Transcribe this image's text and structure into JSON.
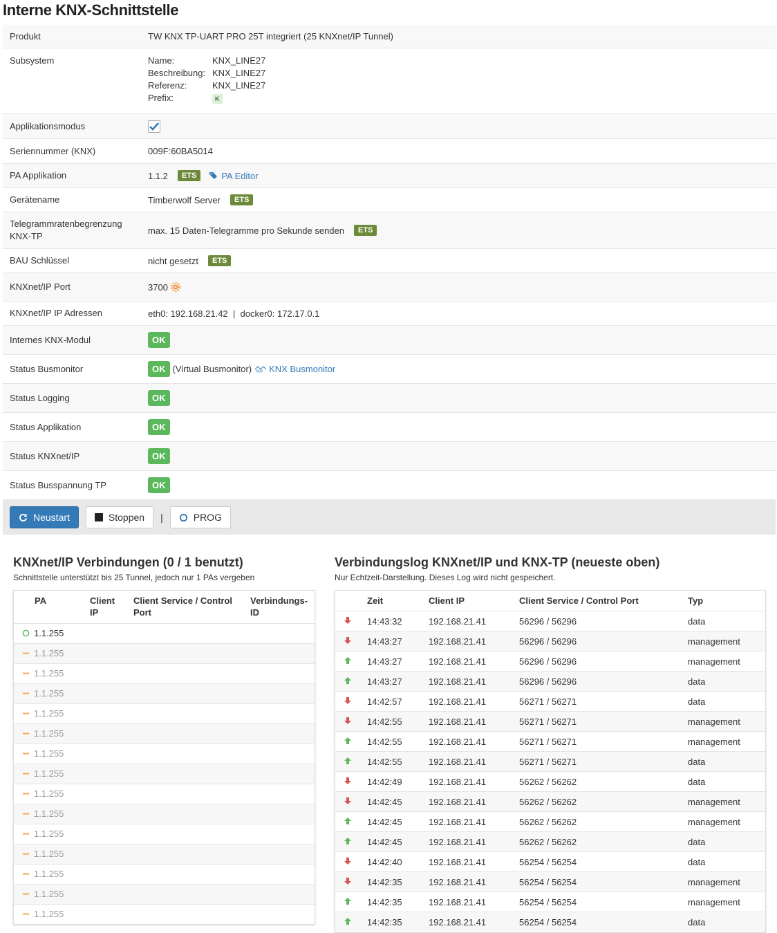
{
  "title": "Interne KNX-Schnittstelle",
  "props": {
    "produkt_label": "Produkt",
    "produkt_value": "TW KNX TP-UART PRO 25T integriert (25 KNXnet/IP Tunnel)",
    "subsystem_label": "Subsystem",
    "subsystem": {
      "name_label": "Name:",
      "name": "KNX_LINE27",
      "beschreibung_label": "Beschreibung:",
      "beschreibung": "KNX_LINE27",
      "referenz_label": "Referenz:",
      "referenz": "KNX_LINE27",
      "prefix_label": "Prefix:",
      "prefix": "K"
    },
    "appmodus_label": "Applikationsmodus",
    "seriennummer_label": "Seriennummer (KNX)",
    "seriennummer": "009F:60BA5014",
    "pa_label": "PA Applikation",
    "pa_value": "1.1.2",
    "ets": "ETS",
    "pa_editor": "PA Editor",
    "geraetename_label": "Gerätename",
    "geraetename": "Timberwolf Server",
    "rate_label": "Telegrammratenbegrenzung KNX-TP",
    "rate_value": "max. 15 Daten-Telegramme pro Sekunde senden",
    "bau_label": "BAU Schlüssel",
    "bau_value": "nicht gesetzt",
    "port_label": "KNXnet/IP Port",
    "port_value": "3700",
    "ip_label": "KNXnet/IP IP Adressen",
    "ip_value": "eth0: 192.168.21.42  |  docker0: 172.17.0.1",
    "modul_label": "Internes KNX-Modul",
    "busmon_label": "Status Busmonitor",
    "busmon_note": "(Virtual Busmonitor)",
    "busmon_link": "KNX Busmonitor",
    "logging_label": "Status Logging",
    "applikation_label": "Status Applikation",
    "knxnetip_label": "Status KNXnet/IP",
    "busspannung_label": "Status Busspannung TP",
    "ok": "OK"
  },
  "toolbar": {
    "neustart": "Neustart",
    "stoppen": "Stoppen",
    "separator": "|",
    "prog": "PROG"
  },
  "connections": {
    "title": "KNXnet/IP Verbindungen (0 / 1 benutzt)",
    "subtitle": "Schnittstelle unterstützt bis 25 Tunnel, jedoch nur 1 PAs vergeben",
    "headers": [
      "PA",
      "Client IP",
      "Client Service / Control Port",
      "Verbindungs-ID"
    ],
    "rows": [
      "1.1.255",
      "1.1.255",
      "1.1.255",
      "1.1.255",
      "1.1.255",
      "1.1.255",
      "1.1.255",
      "1.1.255",
      "1.1.255",
      "1.1.255",
      "1.1.255",
      "1.1.255",
      "1.1.255",
      "1.1.255",
      "1.1.255"
    ]
  },
  "log": {
    "title": "Verbindungslog KNXnet/IP und KNX-TP (neueste oben)",
    "subtitle": "Nur Echtzeit-Darstellung. Dieses Log wird nicht gespeichert.",
    "headers": [
      "Zeit",
      "Client IP",
      "Client Service / Control Port",
      "Typ"
    ],
    "rows": [
      {
        "dir": "down",
        "zeit": "14:43:32",
        "ip": "192.168.21.41",
        "port": "56296 / 56296",
        "typ": "data"
      },
      {
        "dir": "down",
        "zeit": "14:43:27",
        "ip": "192.168.21.41",
        "port": "56296 / 56296",
        "typ": "management"
      },
      {
        "dir": "up",
        "zeit": "14:43:27",
        "ip": "192.168.21.41",
        "port": "56296 / 56296",
        "typ": "management"
      },
      {
        "dir": "up",
        "zeit": "14:43:27",
        "ip": "192.168.21.41",
        "port": "56296 / 56296",
        "typ": "data"
      },
      {
        "dir": "down",
        "zeit": "14:42:57",
        "ip": "192.168.21.41",
        "port": "56271 / 56271",
        "typ": "data"
      },
      {
        "dir": "down",
        "zeit": "14:42:55",
        "ip": "192.168.21.41",
        "port": "56271 / 56271",
        "typ": "management"
      },
      {
        "dir": "up",
        "zeit": "14:42:55",
        "ip": "192.168.21.41",
        "port": "56271 / 56271",
        "typ": "management"
      },
      {
        "dir": "up",
        "zeit": "14:42:55",
        "ip": "192.168.21.41",
        "port": "56271 / 56271",
        "typ": "data"
      },
      {
        "dir": "down",
        "zeit": "14:42:49",
        "ip": "192.168.21.41",
        "port": "56262 / 56262",
        "typ": "data"
      },
      {
        "dir": "down",
        "zeit": "14:42:45",
        "ip": "192.168.21.41",
        "port": "56262 / 56262",
        "typ": "management"
      },
      {
        "dir": "up",
        "zeit": "14:42:45",
        "ip": "192.168.21.41",
        "port": "56262 / 56262",
        "typ": "management"
      },
      {
        "dir": "up",
        "zeit": "14:42:45",
        "ip": "192.168.21.41",
        "port": "56262 / 56262",
        "typ": "data"
      },
      {
        "dir": "down",
        "zeit": "14:42:40",
        "ip": "192.168.21.41",
        "port": "56254 / 56254",
        "typ": "data"
      },
      {
        "dir": "down",
        "zeit": "14:42:35",
        "ip": "192.168.21.41",
        "port": "56254 / 56254",
        "typ": "management"
      },
      {
        "dir": "up",
        "zeit": "14:42:35",
        "ip": "192.168.21.41",
        "port": "56254 / 56254",
        "typ": "management"
      },
      {
        "dir": "up",
        "zeit": "14:42:35",
        "ip": "192.168.21.41",
        "port": "56254 / 56254",
        "typ": "data"
      }
    ]
  }
}
